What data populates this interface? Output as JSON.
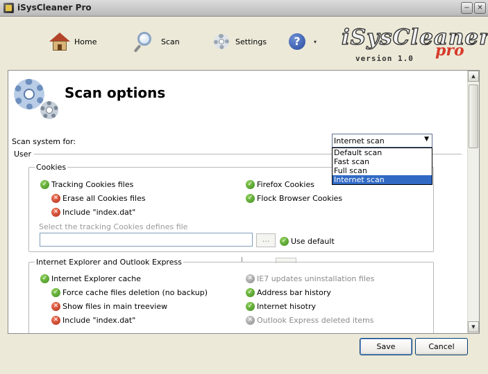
{
  "window": {
    "title": "iSysCleaner Pro",
    "minimize_glyph": "−",
    "close_glyph": "✕"
  },
  "toolbar": {
    "home_label": "Home",
    "scan_label": "Scan",
    "settings_label": "Settings",
    "help_glyph": "?",
    "help_caret": "▾"
  },
  "logo": {
    "name": "iSysCleaner",
    "pro": "pro",
    "version": "version 1.0"
  },
  "main": {
    "title": "Scan options",
    "scan_for_label": "Scan system for:",
    "scan_select": {
      "value": "Internet scan",
      "options": [
        "Default scan",
        "Fast scan",
        "Full scan",
        "Internet scan"
      ],
      "selected_index": 3
    },
    "user_section": "User",
    "cookies_group": {
      "title": "Cookies",
      "left": [
        {
          "label": "Tracking Cookies files",
          "state": "ok"
        },
        {
          "label": "Erase all Cookies files",
          "state": "no"
        },
        {
          "label": "Include \"index.dat\"",
          "state": "no"
        }
      ],
      "right": [
        {
          "label": "Firefox Cookies",
          "state": "ok"
        },
        {
          "label": "Flock Browser Cookies",
          "state": "ok"
        }
      ],
      "path_label": "Select the tracking Cookies defines file",
      "path_value": "",
      "browse_label": "...",
      "use_default_label": "Use default",
      "use_default_state": "ok"
    },
    "ie_group": {
      "title": "Internet Explorer and Outlook Express",
      "left": [
        {
          "label": "Internet Explorer cache",
          "state": "ok"
        },
        {
          "label": "Force cache files deletion (no backup)",
          "state": "ok"
        },
        {
          "label": "Show files in main treeview",
          "state": "no"
        },
        {
          "label": "Include \"index.dat\"",
          "state": "no"
        }
      ],
      "right": [
        {
          "label": "IE7 updates uninstallation files",
          "state": "off"
        },
        {
          "label": "Address bar history",
          "state": "ok"
        },
        {
          "label": "Internet hisotry",
          "state": "ok"
        },
        {
          "label": "Outlook Express deleted items",
          "state": "off"
        }
      ]
    }
  },
  "icons": {
    "ok": "✓",
    "no": "✕",
    "off": "✕",
    "scroll_up": "▲",
    "scroll_down": "▼",
    "select_arrow": "▼"
  },
  "buttons": {
    "save": "Save",
    "cancel": "Cancel"
  },
  "colors": {
    "ok": "#3c8a1c",
    "no": "#b32a14",
    "off": "#8a8a8a",
    "selection": "#316ac5"
  }
}
